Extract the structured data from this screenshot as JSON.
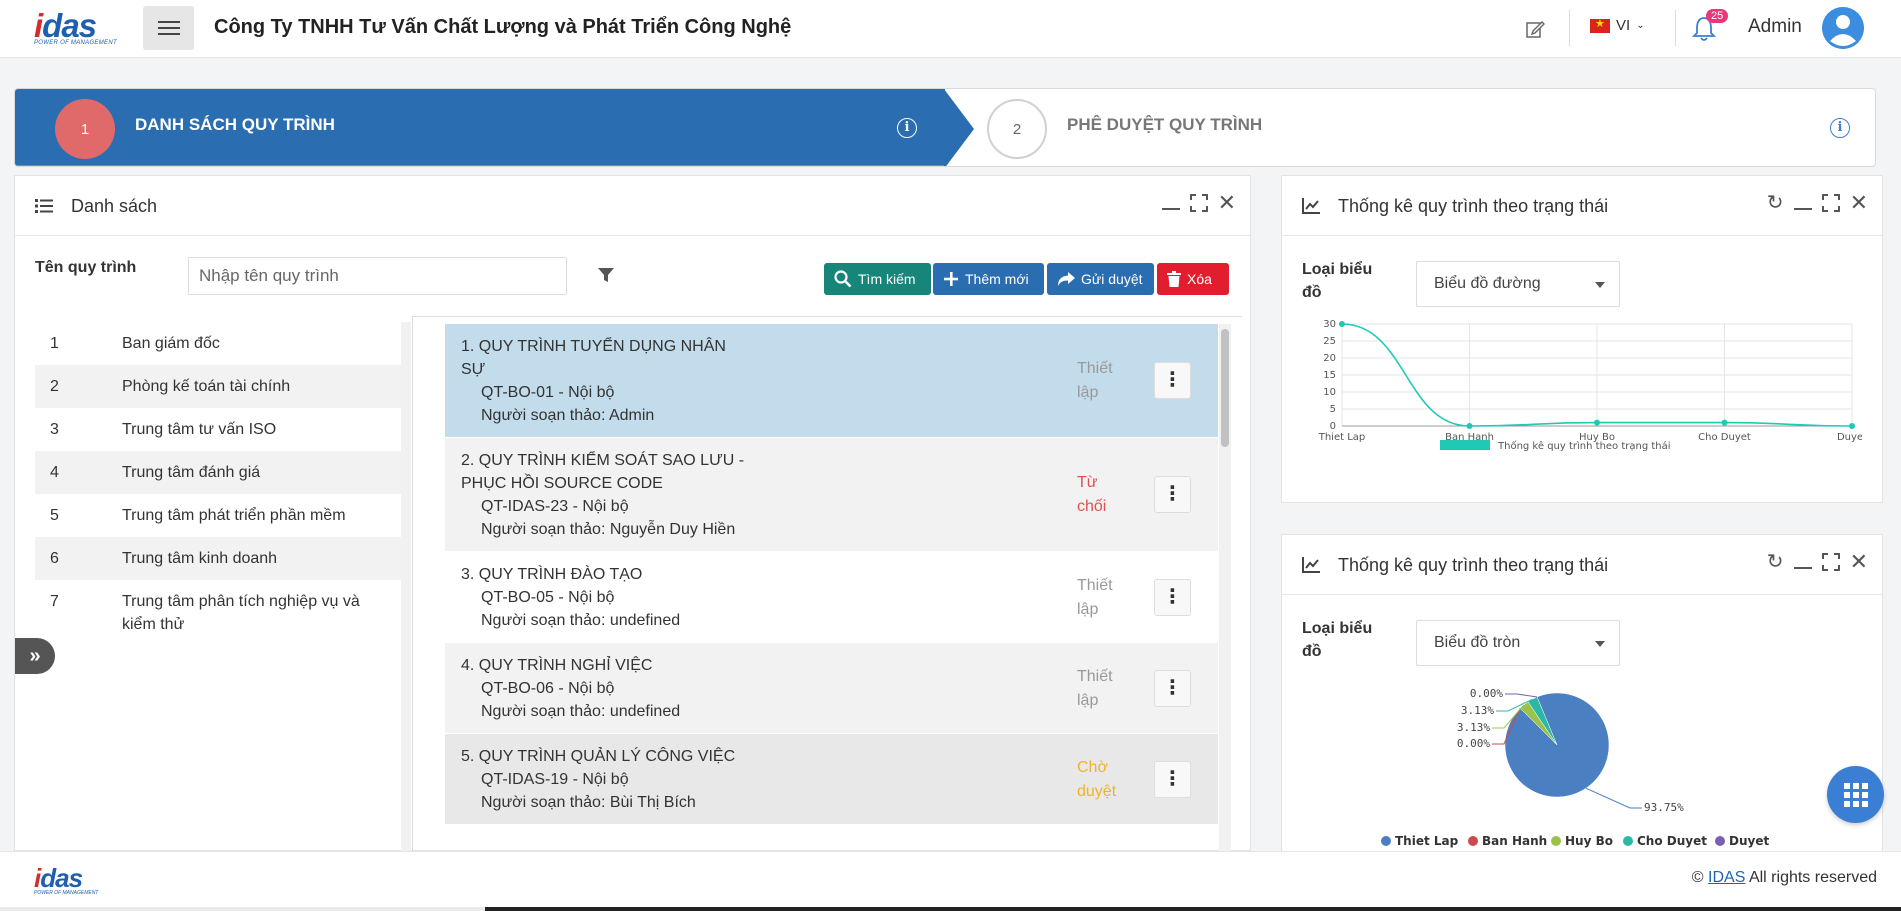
{
  "header": {
    "logo_text": "idas",
    "logo_tagline": "POWER OF MANAGEMENT",
    "company": "Công Ty TNHH Tư Vấn Chất Lượng và Phát Triển Công Nghệ",
    "lang": "VI",
    "notifications": "25",
    "user": "Admin"
  },
  "stepper": {
    "step1_num": "1",
    "step1_label": "DANH SÁCH QUY TRÌNH",
    "step2_num": "2",
    "step2_label": "PHÊ DUYỆT QUY TRÌNH",
    "info": "i"
  },
  "list_panel": {
    "title": "Danh sách",
    "filter_label": "Tên quy trình",
    "filter_placeholder": "Nhập tên quy trình",
    "buttons": {
      "search": "Tìm kiếm",
      "add": "Thêm mới",
      "send": "Gửi duyệt",
      "delete": "Xóa"
    },
    "departments": [
      {
        "num": "1",
        "name": "Ban giám đốc"
      },
      {
        "num": "2",
        "name": "Phòng kế toán tài chính"
      },
      {
        "num": "3",
        "name": "Trung tâm tư vấn ISO"
      },
      {
        "num": "4",
        "name": "Trung tâm đánh giá"
      },
      {
        "num": "5",
        "name": "Trung tâm phát triển phần mềm"
      },
      {
        "num": "6",
        "name": "Trung tâm kinh doanh"
      },
      {
        "num": "7",
        "name": "Trung tâm phân tích nghiệp vụ và kiểm thử"
      }
    ],
    "processes": [
      {
        "title": "1. QUY TRÌNH TUYỂN DỤNG NHÂN SỰ",
        "code": "QT-BO-01 - Nội bộ",
        "author": "Người soạn thảo: Admin",
        "status": "Thiết lập",
        "status_color": "#999999",
        "bg": "#c3dceb"
      },
      {
        "title": "2. QUY TRÌNH KIỂM SOÁT SAO LƯU - PHỤC HỒI SOURCE CODE",
        "code": "QT-IDAS-23 - Nội bộ",
        "author": "Người soạn thảo: Nguyễn Duy Hiền",
        "status": "Từ chối",
        "status_color": "#e05050",
        "bg": "#f2f2f2"
      },
      {
        "title": "3. QUY TRÌNH ĐÀO TẠO",
        "code": "QT-BO-05 - Nội bộ",
        "author": "Người soạn thảo: undefined",
        "status": "Thiết lập",
        "status_color": "#999999",
        "bg": "#ffffff"
      },
      {
        "title": "4. QUY TRÌNH NGHỈ VIỆC",
        "code": "QT-BO-06 - Nội bộ",
        "author": "Người soạn thảo: undefined",
        "status": "Thiết lập",
        "status_color": "#999999",
        "bg": "#f2f2f2"
      },
      {
        "title": "5. QUY TRÌNH QUẢN LÝ CÔNG VIỆC",
        "code": "QT-IDAS-19 - Nội bộ",
        "author": "Người soạn thảo: Bùi Thị Bích",
        "status": "Chờ duyệt",
        "status_color": "#f0b429",
        "bg": "#e8e8e8"
      }
    ]
  },
  "stats_line": {
    "title": "Thống kê quy trình theo trạng thái",
    "type_label": "Loại biểu đồ",
    "type_value": "Biểu đồ đường"
  },
  "stats_pie": {
    "title": "Thống kê quy trình theo trạng thái",
    "type_label": "Loại biểu đồ",
    "type_value": "Biểu đồ tròn"
  },
  "chart_data": [
    {
      "type": "line",
      "categories": [
        "Thiet Lap",
        "Ban Hanh",
        "Huy Bo",
        "Cho Duyet",
        "Duyet"
      ],
      "values": [
        30,
        0,
        1,
        1,
        0
      ],
      "series_name": "Thống kê quy trình theo trạng thái",
      "ylim": [
        0,
        30
      ],
      "yticks": [
        "30",
        "25",
        "20",
        "15",
        "10",
        "5",
        "0"
      ],
      "color": "#20c9b6"
    },
    {
      "type": "pie",
      "labels": [
        "Thiet Lap",
        "Ban Hanh",
        "Huy Bo",
        "Cho Duyet",
        "Duyet"
      ],
      "values": [
        93.75,
        0.0,
        3.13,
        3.13,
        0.0
      ],
      "value_labels": [
        "93.75%",
        "0.00%",
        "3.13%",
        "3.13%",
        "0.00%"
      ],
      "colors": [
        "#4a7fc1",
        "#cc4a4a",
        "#9bc34a",
        "#2bb9a6",
        "#7b5fb4"
      ]
    }
  ],
  "footer": {
    "copyright_prefix": "©",
    "copyright_link": "IDAS",
    "copyright_suffix": "All rights reserved"
  }
}
